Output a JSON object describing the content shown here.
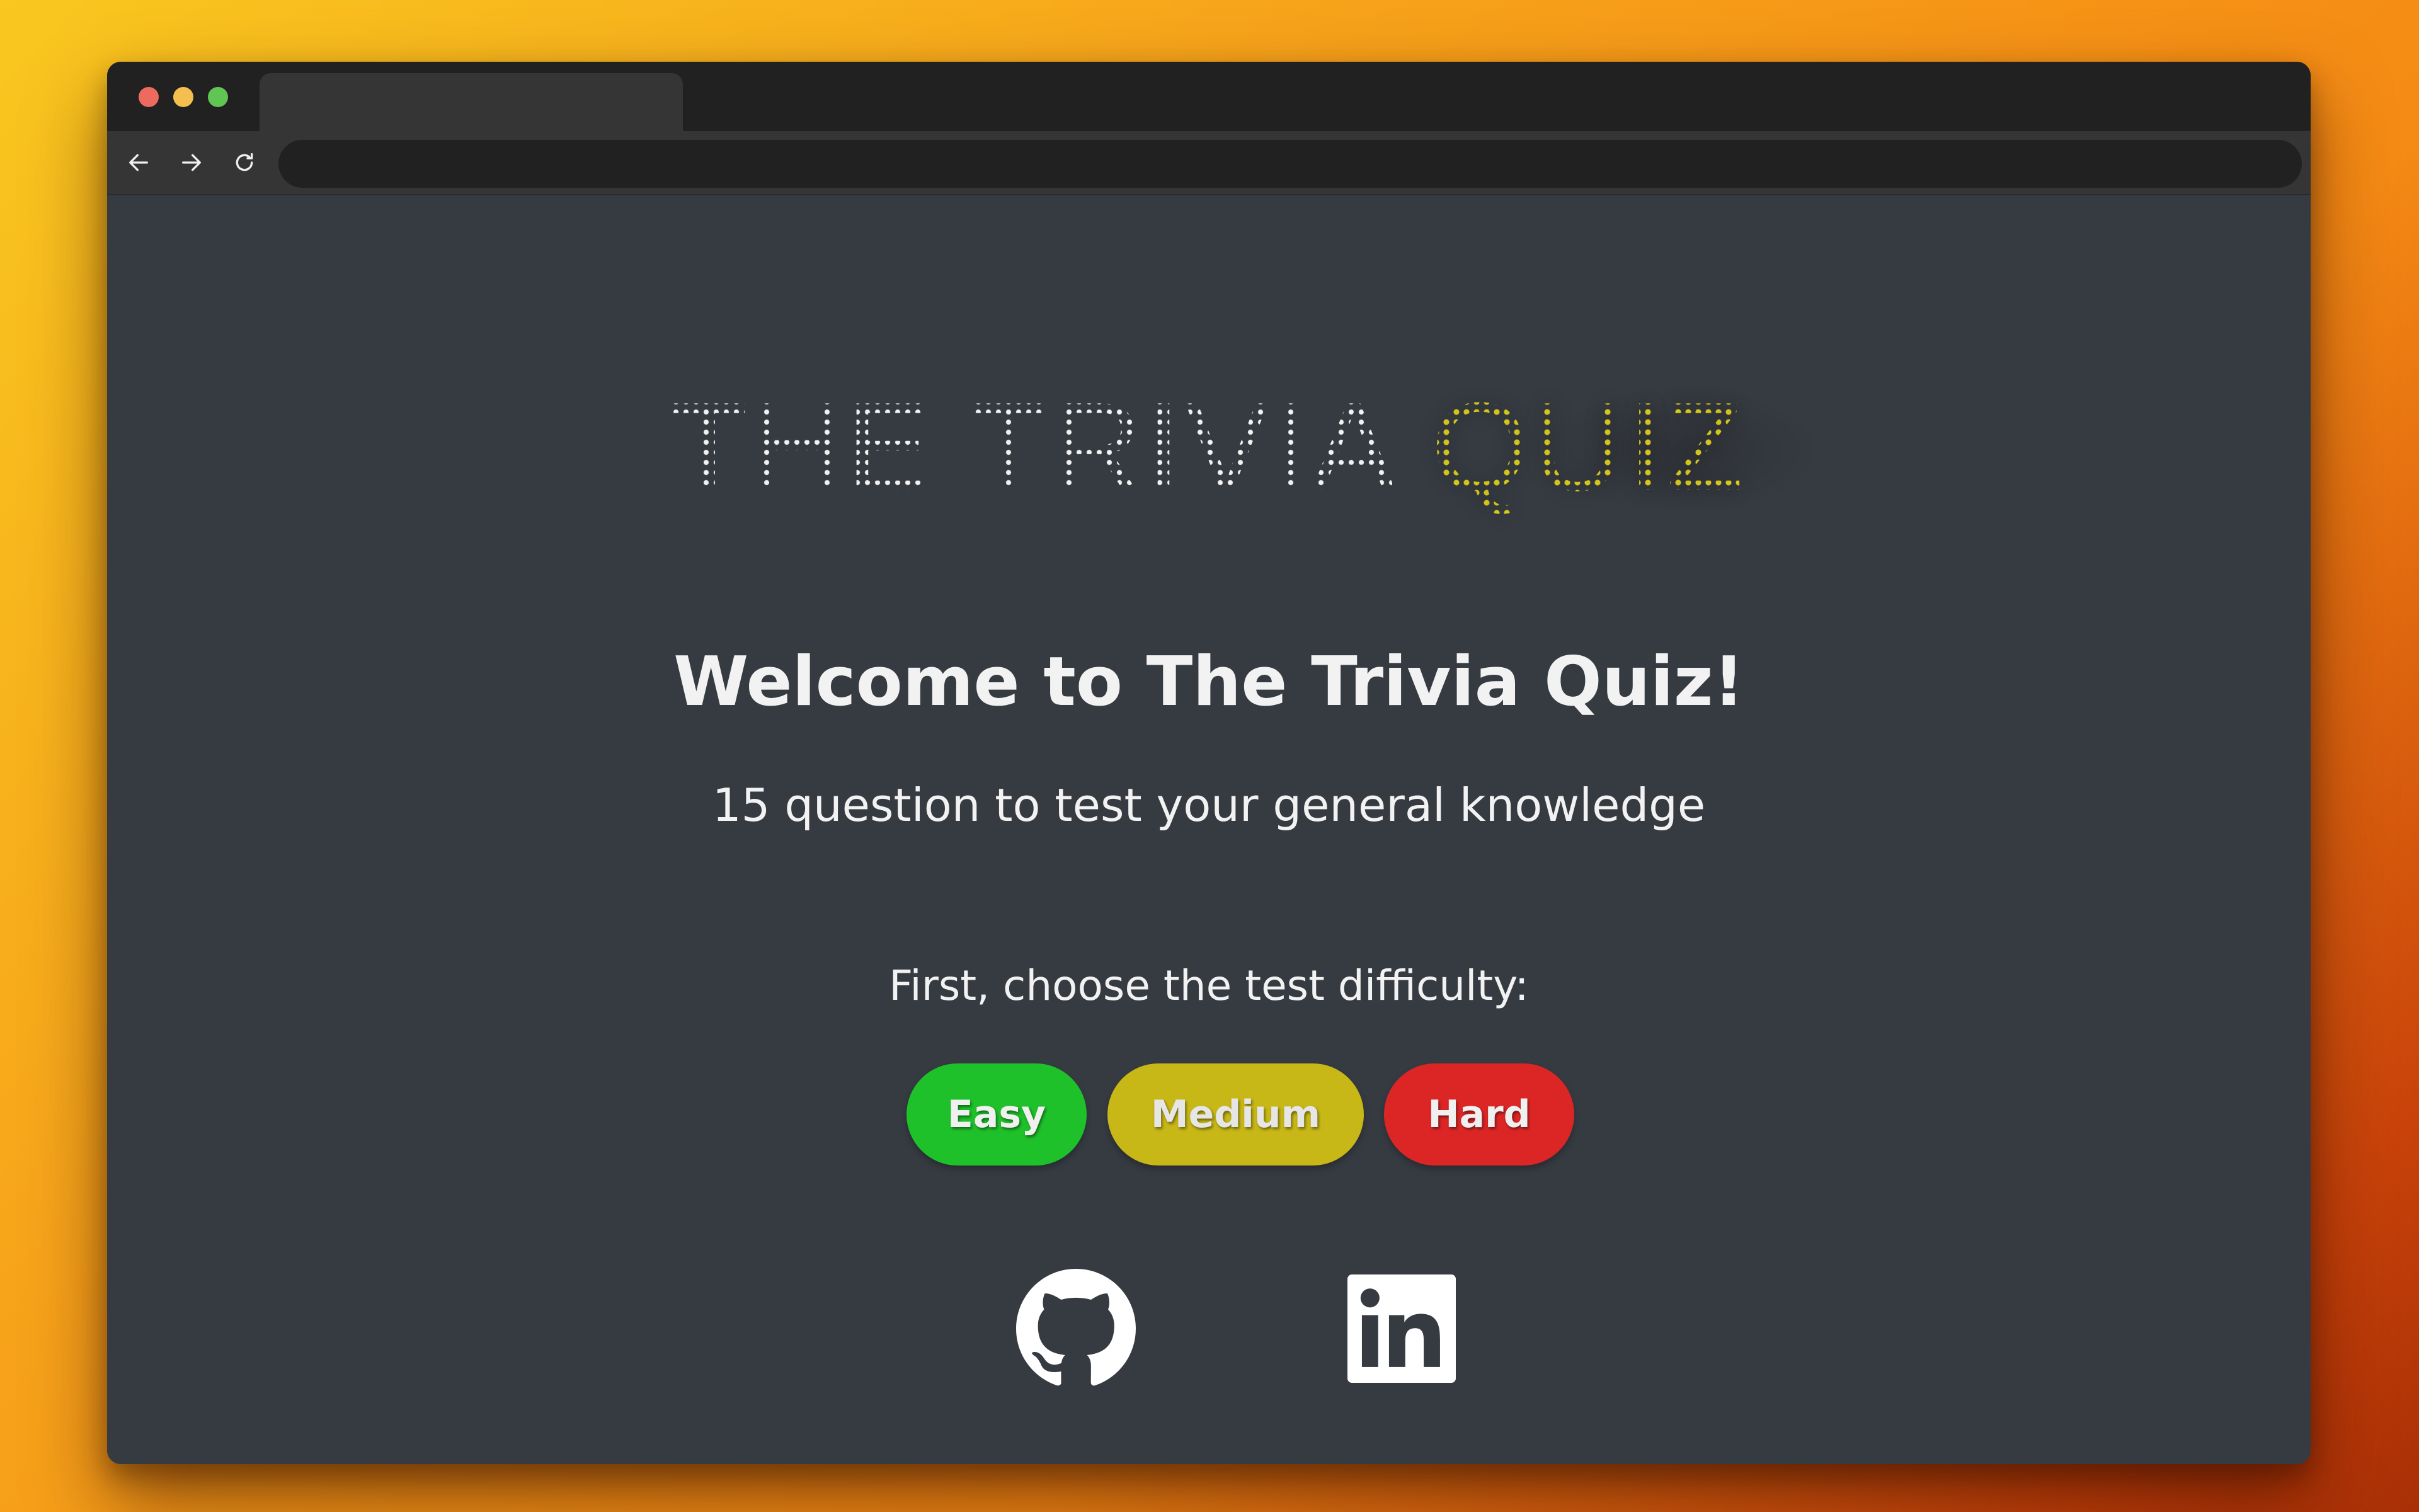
{
  "browser": {
    "tab_title": "",
    "address": "",
    "back_icon": "arrow-left-icon",
    "forward_icon": "arrow-right-icon",
    "reload_icon": "reload-icon"
  },
  "page": {
    "logo": {
      "part1": "THE TRIVIA",
      "part2": "QUIZ",
      "colors": {
        "part1": "#f2f2f2",
        "part2": "#e3d21b"
      }
    },
    "welcome": "Welcome to The Trivia Quiz!",
    "subtitle": "15 question to test your general knowledge",
    "difficulty_prompt": "First, choose the test difficulty:",
    "difficulty_buttons": [
      {
        "label": "Easy",
        "color": "#1ec12a"
      },
      {
        "label": "Medium",
        "color": "#c7b717"
      },
      {
        "label": "Hard",
        "color": "#dc2626"
      }
    ],
    "social_links": [
      {
        "icon": "github-icon"
      },
      {
        "icon": "linkedin-icon"
      }
    ]
  }
}
